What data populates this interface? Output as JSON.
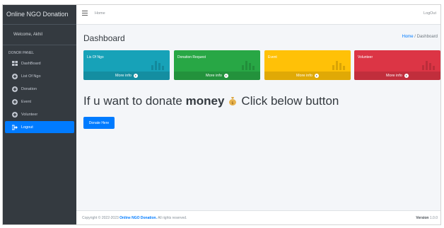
{
  "sidebar": {
    "brand": "Online NGO Donation",
    "welcome": "Welcome, Akhil",
    "panel_header": "DONOR PANEL",
    "items": [
      {
        "label": "DashBoard",
        "icon": "grid-icon"
      },
      {
        "label": "List Of Ngo",
        "icon": "plus-circle-icon"
      },
      {
        "label": "Donation",
        "icon": "plus-circle-icon"
      },
      {
        "label": "Event",
        "icon": "plus-circle-icon"
      },
      {
        "label": "Volunteer",
        "icon": "plus-circle-icon"
      },
      {
        "label": "Logout",
        "icon": "sign-out-icon"
      }
    ]
  },
  "topbar": {
    "home_link": "Home",
    "logout": "LogOut"
  },
  "content": {
    "title": "Dashboard",
    "breadcrumb": {
      "home": "Home",
      "separator": "/",
      "current": "Dashboard"
    },
    "boxes": [
      {
        "label": "Lis Of Ngo",
        "footer": "More info",
        "color": "#17a2b8"
      },
      {
        "label": "Donation Request",
        "footer": "More info",
        "color": "#28a745"
      },
      {
        "label": "Event",
        "footer": "More info",
        "color": "#ffc107"
      },
      {
        "label": "Volunteer",
        "footer": "More info",
        "color": "#dc3545"
      }
    ],
    "headline_pre": "If u want to donate",
    "headline_bold": "money",
    "headline_post": "Click below button",
    "donate_button": "Donate Here"
  },
  "footer": {
    "copyright": "Copyright © 2022-2023",
    "brand": "Online NGO Donation.",
    "rights": "All rights reserved.",
    "version_label": "Version",
    "version_value": "1.0.0"
  },
  "colors": {
    "sidebar": "#343a40",
    "accent": "#007bff"
  }
}
